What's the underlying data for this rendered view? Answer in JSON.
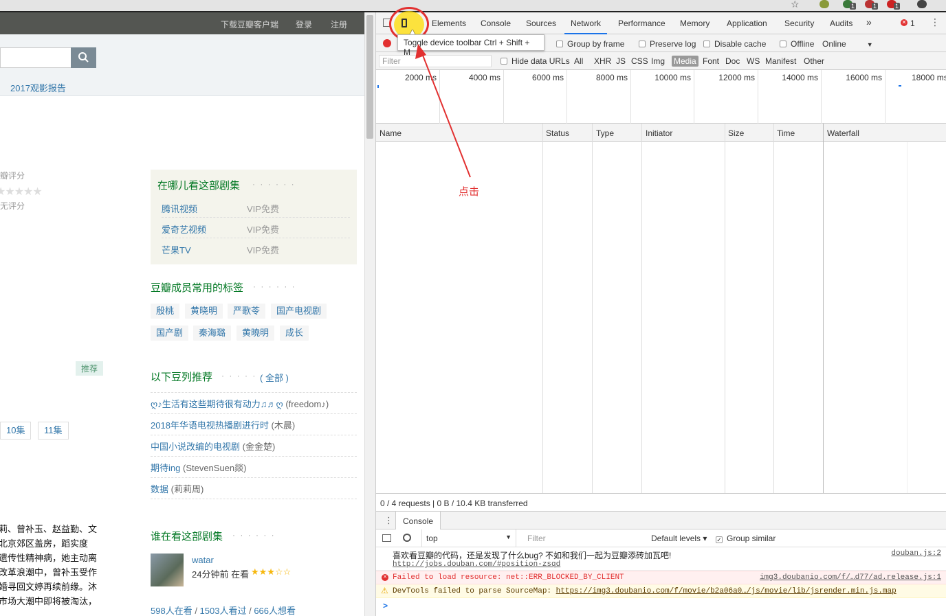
{
  "page": {
    "topnav": [
      "下载豆瓣客户端",
      "登录",
      "注册"
    ],
    "report_link": "2017观影报告",
    "rating_label": "豆瓣评分",
    "rating_none": "暂无评分",
    "where_title": "在哪儿看这部剧集",
    "where_dots": "· · · · · ·",
    "where_rows": [
      {
        "name": "腾讯视频",
        "price": "VIP免费"
      },
      {
        "name": "爱奇艺视频",
        "price": "VIP免费"
      },
      {
        "name": "芒果TV",
        "price": "VIP免费"
      }
    ],
    "tags_title": "豆瓣成员常用的标签",
    "tags_dots": "· · · · · ·",
    "tags_row1": [
      "殷桃",
      "黄晓明",
      "严歌苓",
      "国产电视剧"
    ],
    "tags_row2": [
      "国产剧",
      "秦海璐",
      "黄曉明",
      "成长"
    ],
    "recommend_badge": "推荐",
    "doulist_title": "以下豆列推荐",
    "doulist_dots": "· · · · · ·",
    "doulist_all": "( 全部 )",
    "doulists": [
      {
        "title": "ღ♪生活有这些期待很有动力♫♬ღ",
        "author": "(freedom♪)"
      },
      {
        "title": "2018年华语电视热播剧进行时",
        "author": "(木晨)"
      },
      {
        "title": "中国小说改编的电视剧",
        "author": "(金金楚)"
      },
      {
        "title": "期待ing",
        "author": "(StevenSuen燚)"
      },
      {
        "title": "数据",
        "author": "(莉莉周)"
      }
    ],
    "episodes": [
      "10集",
      "11集"
    ],
    "synopsis": [
      "莉、曾补玉、赵益勤、文",
      "北京郊区盖房，蹈实度",
      "遗传性精神病，她主动离",
      "改革浪潮中，曾补玉受作",
      "婚寻回文婷再续前缘。沐",
      "市场大潮中即将被淘汰，"
    ],
    "watching_title": "谁在看这部剧集",
    "watching_dots": "· · · · · ·",
    "watcher_name": "watar",
    "watcher_time": "24分钟前 在看",
    "watcher_stars": "★★★☆☆",
    "counts": [
      "598人在看",
      "1503人看过",
      "666人想看"
    ]
  },
  "devtools": {
    "tabs": [
      "Elements",
      "Console",
      "Sources",
      "Network",
      "Performance",
      "Memory",
      "Application",
      "Security",
      "Audits"
    ],
    "more": "»",
    "error_count": "1",
    "tooltip": "Toggle device toolbar  Ctrl + Shift + M",
    "toolbar": {
      "group_by_frame": "Group by frame",
      "preserve_log": "Preserve log",
      "disable_cache": "Disable cache",
      "offline": "Offline",
      "online": "Online"
    },
    "filter_placeholder": "Filter",
    "hide_data_urls": "Hide data URLs",
    "filter_types": [
      "All",
      "XHR",
      "JS",
      "CSS",
      "Img",
      "Media",
      "Font",
      "Doc",
      "WS",
      "Manifest",
      "Other"
    ],
    "active_filter": "Media",
    "timeline_ticks": [
      "2000 ms",
      "4000 ms",
      "6000 ms",
      "8000 ms",
      "10000 ms",
      "12000 ms",
      "14000 ms",
      "16000 ms",
      "18000 ms"
    ],
    "columns": [
      "Name",
      "Status",
      "Type",
      "Initiator",
      "Size",
      "Time",
      "Waterfall"
    ],
    "summary": "0 / 4 requests  |  0 B / 10.4 KB transferred",
    "console": {
      "tab": "Console",
      "context": "top",
      "filter_placeholder": "Filter",
      "levels": "Default levels ▾",
      "group_similar": "Group similar",
      "messages": [
        {
          "type": "log",
          "text": "喜欢看豆瓣的代码，还是发现了什么bug? 不如和我们一起为豆瓣添砖加瓦吧!",
          "link": "http://jobs.douban.com/#position-zsqd",
          "source": "douban.js:2"
        },
        {
          "type": "error",
          "text": "Failed to load resource: net::ERR_BLOCKED_BY_CLIENT",
          "source": "img3.doubanio.com/f/…d77/ad.release.js:1"
        },
        {
          "type": "warning",
          "text": "DevTools failed to parse SourceMap: ",
          "link": "https://img3.doubanio.com/f/movie/b2a06a0…/js/movie/lib/jsrender.min.js.map"
        }
      ],
      "prompt": ">"
    }
  },
  "annotation": {
    "text": "点击"
  },
  "colors": {
    "accent_red": "#e23030",
    "douban_green": "#007722",
    "link_blue": "#3377aa",
    "devtools_blue": "#1a73e8"
  }
}
